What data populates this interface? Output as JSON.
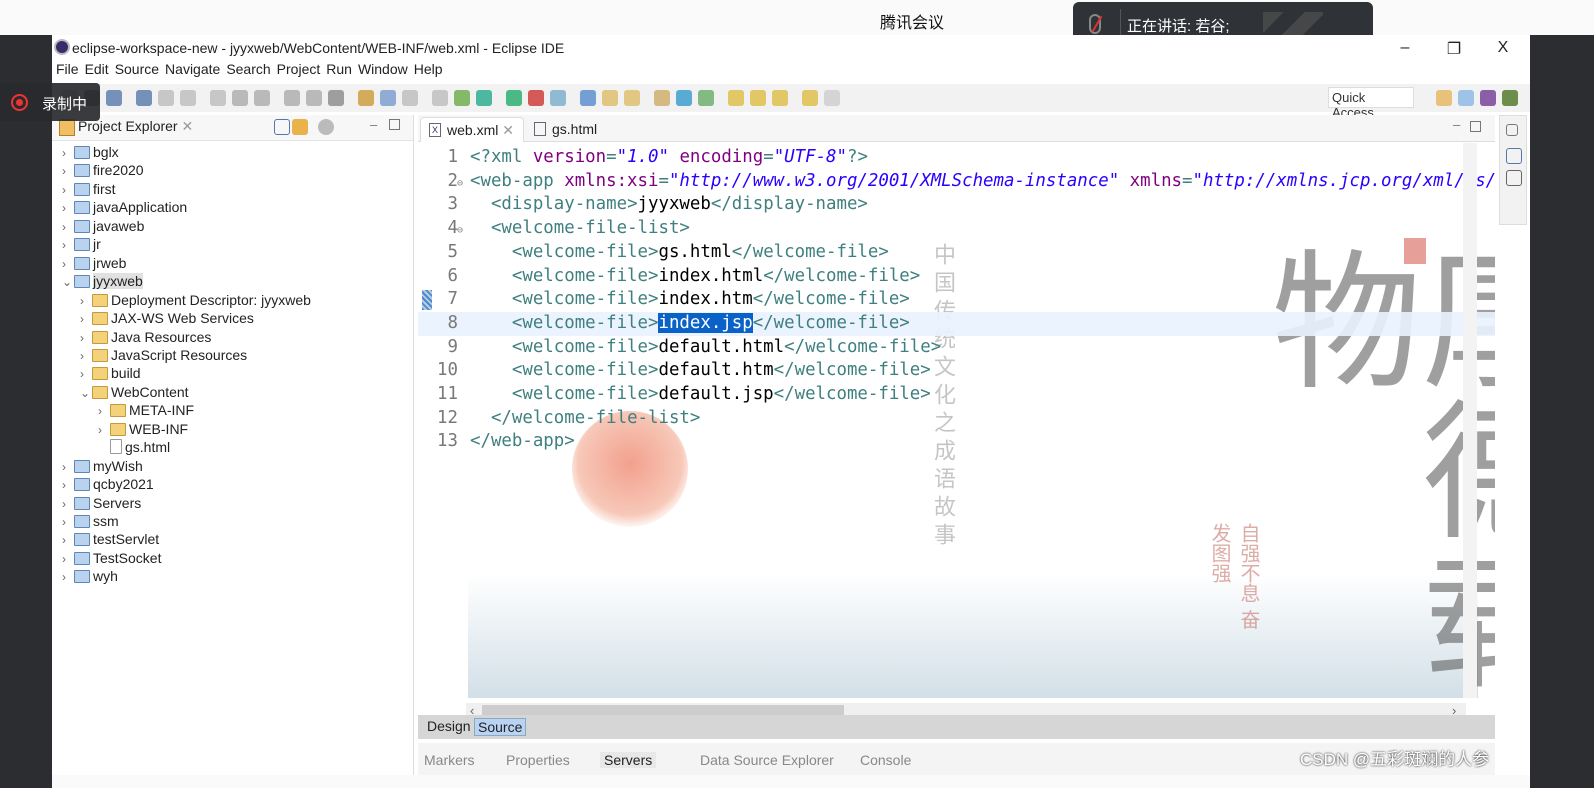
{
  "meeting": {
    "app_title": "腾讯会议",
    "speaking_text": "正在讲话: 若谷;",
    "recording_label": "录制中"
  },
  "window": {
    "title": "eclipse-workspace-new - jyyxweb/WebContent/WEB-INF/web.xml - Eclipse IDE",
    "minimize": "–",
    "restore": "❐",
    "close": "X"
  },
  "menu": [
    "File",
    "Edit",
    "Source",
    "Navigate",
    "Search",
    "Project",
    "Run",
    "Window",
    "Help"
  ],
  "toolbar": {
    "quick_access": "Quick Access"
  },
  "project_explorer": {
    "title": "Project Explorer",
    "close": "✕",
    "items": [
      {
        "label": "bglx",
        "depth": 0,
        "chev": "›",
        "kind": "proj"
      },
      {
        "label": "fire2020",
        "depth": 0,
        "chev": "›",
        "kind": "proj"
      },
      {
        "label": "first",
        "depth": 0,
        "chev": "›",
        "kind": "proj"
      },
      {
        "label": "javaApplication",
        "depth": 0,
        "chev": "›",
        "kind": "proj"
      },
      {
        "label": "javaweb",
        "depth": 0,
        "chev": "›",
        "kind": "proj"
      },
      {
        "label": "jr",
        "depth": 0,
        "chev": "›",
        "kind": "proj"
      },
      {
        "label": "jrweb",
        "depth": 0,
        "chev": "›",
        "kind": "proj"
      },
      {
        "label": "jyyxweb",
        "depth": 0,
        "chev": "⌄",
        "kind": "proj",
        "selected": true
      },
      {
        "label": "Deployment Descriptor: jyyxweb",
        "depth": 1,
        "chev": "›",
        "kind": "dd"
      },
      {
        "label": "JAX-WS Web Services",
        "depth": 1,
        "chev": "›",
        "kind": "ws"
      },
      {
        "label": "Java Resources",
        "depth": 1,
        "chev": "›",
        "kind": "jr"
      },
      {
        "label": "JavaScript Resources",
        "depth": 1,
        "chev": "›",
        "kind": "js"
      },
      {
        "label": "build",
        "depth": 1,
        "chev": "›",
        "kind": "folder"
      },
      {
        "label": "WebContent",
        "depth": 1,
        "chev": "⌄",
        "kind": "folder"
      },
      {
        "label": "META-INF",
        "depth": 2,
        "chev": "›",
        "kind": "folder"
      },
      {
        "label": "WEB-INF",
        "depth": 2,
        "chev": "›",
        "kind": "folder"
      },
      {
        "label": "gs.html",
        "depth": 2,
        "chev": "",
        "kind": "file"
      },
      {
        "label": "myWish",
        "depth": 0,
        "chev": "›",
        "kind": "proj"
      },
      {
        "label": "qcby2021",
        "depth": 0,
        "chev": "›",
        "kind": "proj"
      },
      {
        "label": "Servers",
        "depth": 0,
        "chev": "›",
        "kind": "proj"
      },
      {
        "label": "ssm",
        "depth": 0,
        "chev": "›",
        "kind": "proj"
      },
      {
        "label": "testServlet",
        "depth": 0,
        "chev": "›",
        "kind": "proj"
      },
      {
        "label": "TestSocket",
        "depth": 0,
        "chev": "›",
        "kind": "proj"
      },
      {
        "label": "wyh",
        "depth": 0,
        "chev": "›",
        "kind": "proj"
      }
    ]
  },
  "editor": {
    "tabs": [
      {
        "label": "web.xml",
        "icon": "X",
        "active": true,
        "close": "✕"
      },
      {
        "label": "gs.html",
        "icon": "",
        "active": false
      }
    ],
    "current_line": 8,
    "lines": [
      [
        [
          "tag",
          "<?xml "
        ],
        [
          "attr",
          "version"
        ],
        [
          "tag",
          "="
        ],
        [
          "val",
          "\"1.0\""
        ],
        [
          "tag",
          " "
        ],
        [
          "attr",
          "encoding"
        ],
        [
          "tag",
          "="
        ],
        [
          "val",
          "\"UTF-8\""
        ],
        [
          "tag",
          "?>"
        ]
      ],
      [
        [
          "tag",
          "<web-app "
        ],
        [
          "attr",
          "xmlns:xsi"
        ],
        [
          "tag",
          "="
        ],
        [
          "val",
          "\"http://www.w3.org/2001/XMLSchema-instance\""
        ],
        [
          "tag",
          " "
        ],
        [
          "attr",
          "xmlns"
        ],
        [
          "tag",
          "="
        ],
        [
          "val",
          "\"http://xmlns.jcp.org/xml/ns/javaee\""
        ]
      ],
      [
        [
          "text",
          "  "
        ],
        [
          "tag",
          "<display-name>"
        ],
        [
          "text",
          "jyyxweb"
        ],
        [
          "tag",
          "</display-name>"
        ]
      ],
      [
        [
          "text",
          "  "
        ],
        [
          "tag",
          "<welcome-file-list>"
        ]
      ],
      [
        [
          "text",
          "    "
        ],
        [
          "tag",
          "<welcome-file>"
        ],
        [
          "text",
          "gs.html"
        ],
        [
          "tag",
          "</welcome-file>"
        ]
      ],
      [
        [
          "text",
          "    "
        ],
        [
          "tag",
          "<welcome-file>"
        ],
        [
          "text",
          "index.html"
        ],
        [
          "tag",
          "</welcome-file>"
        ]
      ],
      [
        [
          "text",
          "    "
        ],
        [
          "tag",
          "<welcome-file>"
        ],
        [
          "text",
          "index.htm"
        ],
        [
          "tag",
          "</welcome-file>"
        ]
      ],
      [
        [
          "text",
          "    "
        ],
        [
          "tag",
          "<welcome-file>"
        ],
        [
          "sel",
          "index.jsp"
        ],
        [
          "tag",
          "</welcome-file>"
        ]
      ],
      [
        [
          "text",
          "    "
        ],
        [
          "tag",
          "<welcome-file>"
        ],
        [
          "text",
          "default.html"
        ],
        [
          "tag",
          "</welcome-file>"
        ]
      ],
      [
        [
          "text",
          "    "
        ],
        [
          "tag",
          "<welcome-file>"
        ],
        [
          "text",
          "default.htm"
        ],
        [
          "tag",
          "</welcome-file>"
        ]
      ],
      [
        [
          "text",
          "    "
        ],
        [
          "tag",
          "<welcome-file>"
        ],
        [
          "text",
          "default.jsp"
        ],
        [
          "tag",
          "</welcome-file>"
        ]
      ],
      [
        [
          "text",
          "  "
        ],
        [
          "tag",
          "</welcome-file-list>"
        ]
      ],
      [
        [
          "tag",
          "</web-app>"
        ]
      ]
    ],
    "folds": [
      2,
      4
    ],
    "art": {
      "big": "厚德载物",
      "series": "中国传统文化之成语故事",
      "motto": "自强不息 奋发图强"
    },
    "design_tab": "Design",
    "source_tab": "Source"
  },
  "bottom_tabs": [
    "Markers",
    "Properties",
    "Servers",
    "Data Source Explorer",
    "Console"
  ],
  "bottom_active": "Servers",
  "watermark": "CSDN @五彩斑斓的人参",
  "colors": {
    "tag": "#3f7f7f",
    "attr": "#7f007f",
    "value": "#2a00ff",
    "selection": "#0a62c8"
  }
}
